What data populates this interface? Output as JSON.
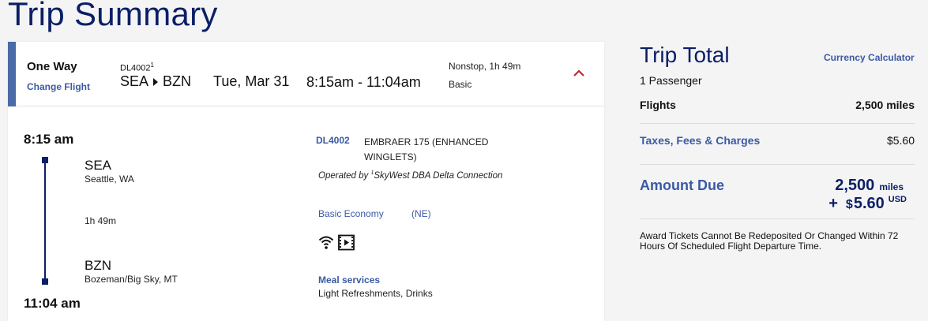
{
  "page": {
    "title": "Trip Summary"
  },
  "header": {
    "trip_type": "One Way",
    "change_flight": "Change Flight",
    "flight_number": "DL4002",
    "flight_number_sup": "1",
    "origin": "SEA",
    "destination": "BZN",
    "date": "Tue, Mar 31",
    "time_range": "8:15am - 11:04am",
    "stops": "Nonstop, 1h 49m",
    "fare_class": "Basic"
  },
  "segment": {
    "departure_time": "8:15 am",
    "arrival_time": "11:04 am",
    "origin_code": "SEA",
    "origin_city": "Seattle, WA",
    "duration": "1h 49m",
    "dest_code": "BZN",
    "dest_city": "Bozeman/Big Sky, MT",
    "flight_number": "DL4002",
    "aircraft": "EMBRAER 175 (ENHANCED WINGLETS)",
    "operated_prefix": "Operated by ",
    "operated_sup": "1",
    "operator": "SkyWest DBA Delta Connection",
    "cabin": "Basic Economy",
    "cabin_code": "(NE)",
    "amenities": [
      "wifi-icon",
      "video-icon"
    ],
    "meal_label": "Meal services",
    "meal_value": "Light Refreshments, Drinks"
  },
  "trip_total": {
    "title": "Trip Total",
    "currency_calculator": "Currency Calculator",
    "passengers": "1 Passenger",
    "flights_label": "Flights",
    "flights_value": "2,500 miles",
    "taxes_label": "Taxes, Fees & Charges",
    "taxes_value": "$5.60",
    "amount_due_label": "Amount Due",
    "due_miles": "2,500",
    "due_miles_unit": "miles",
    "due_plus": "+",
    "due_currency_symbol": "$",
    "due_cash": "5.60",
    "due_cash_unit": "USD",
    "award_note": "Award Tickets Cannot Be Redeposited Or Changed Within 72 Hours Of Scheduled Flight Departure Time."
  },
  "colors": {
    "brand_navy": "#0b1f66",
    "link_blue": "#3b5aa5",
    "accent_bar": "#4a6aa8",
    "collapse_red": "#c0282d"
  }
}
